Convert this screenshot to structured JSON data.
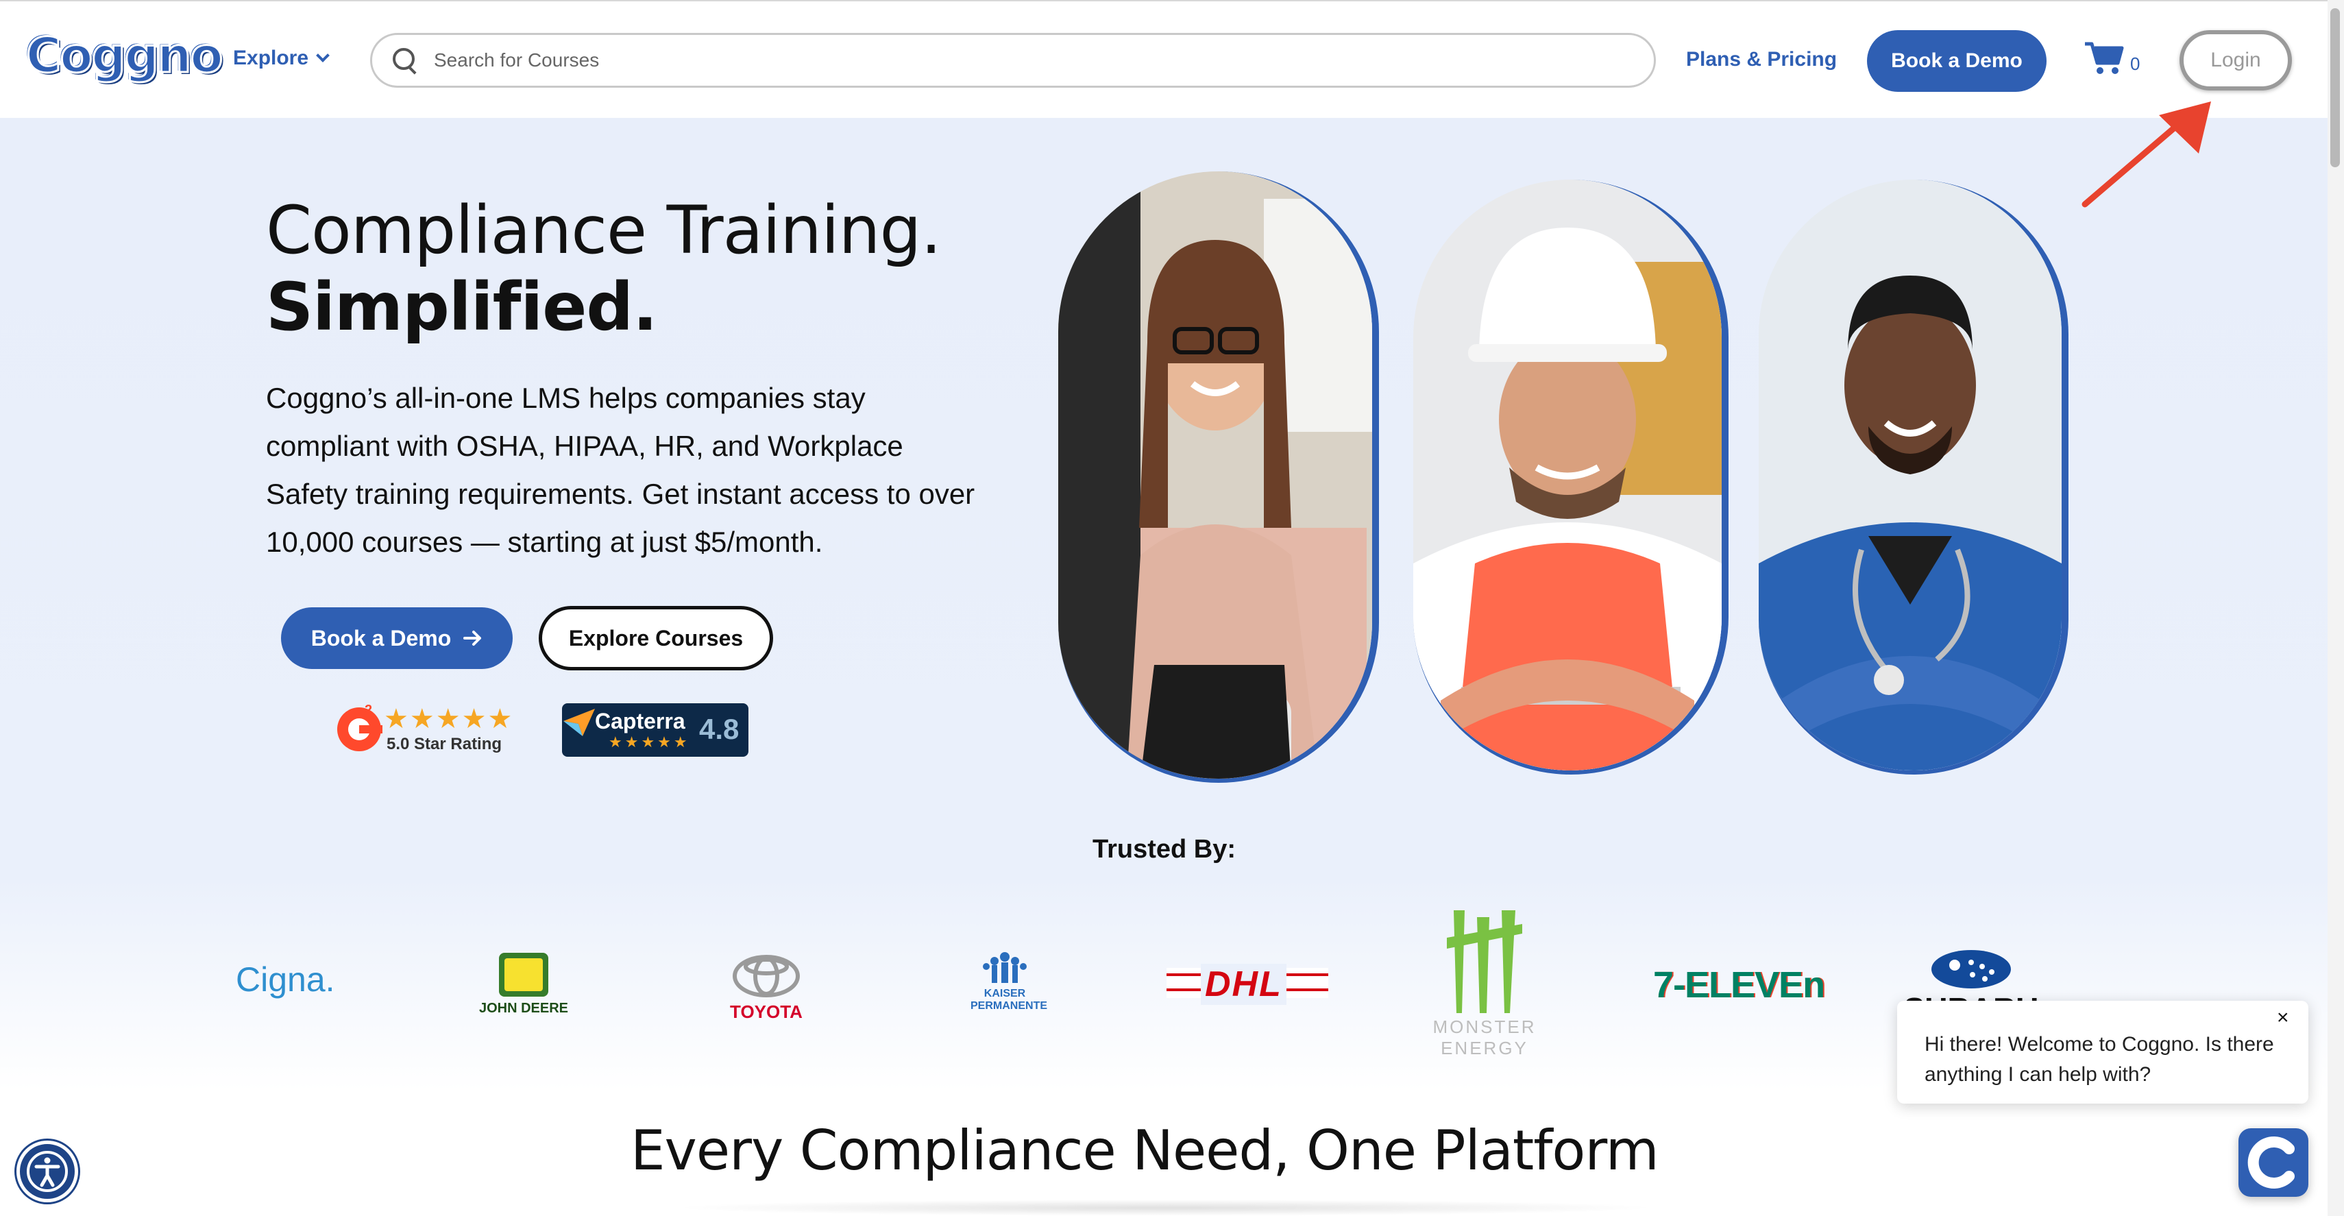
{
  "header": {
    "logo_text": "Coggno",
    "explore_label": "Explore",
    "search_placeholder": "Search for Courses",
    "plans_label": "Plans & Pricing",
    "book_demo_label": "Book a Demo",
    "cart_count": "0",
    "login_label": "Login"
  },
  "hero": {
    "title_line1": "Compliance Training.",
    "title_line2": "Simplified.",
    "description": "Coggno’s all-in-one LMS helps companies stay compliant with OSHA, HIPAA, HR, and Workplace Safety training requirements. Get instant access to over 10,000 courses — starting at just $5/month.",
    "book_demo_label": "Book a Demo",
    "explore_courses_label": "Explore Courses",
    "g2_rating_text": "5.0 Star Rating",
    "g2_stars": "★★★★★",
    "capterra_name": "Capterra",
    "capterra_stars": "★★★★★",
    "capterra_score": "4.8"
  },
  "trusted": {
    "label": "Trusted By:",
    "logos": [
      "Cigna.",
      "JOHN DEERE",
      "TOYOTA",
      "KAISER PERMANENTE",
      "DHL",
      "MONSTER ENERGY",
      "7-ELEVEn",
      "SUBARU"
    ]
  },
  "section": {
    "heading": "Every Compliance Need, One Platform"
  },
  "chat": {
    "message": "Hi there! Welcome to Coggno. Is there anything I can help with?",
    "close_label": "×"
  },
  "colors": {
    "brand_blue": "#2f5fb3",
    "hero_bg": "#e8eefa",
    "annotation_red": "#e8432e"
  }
}
